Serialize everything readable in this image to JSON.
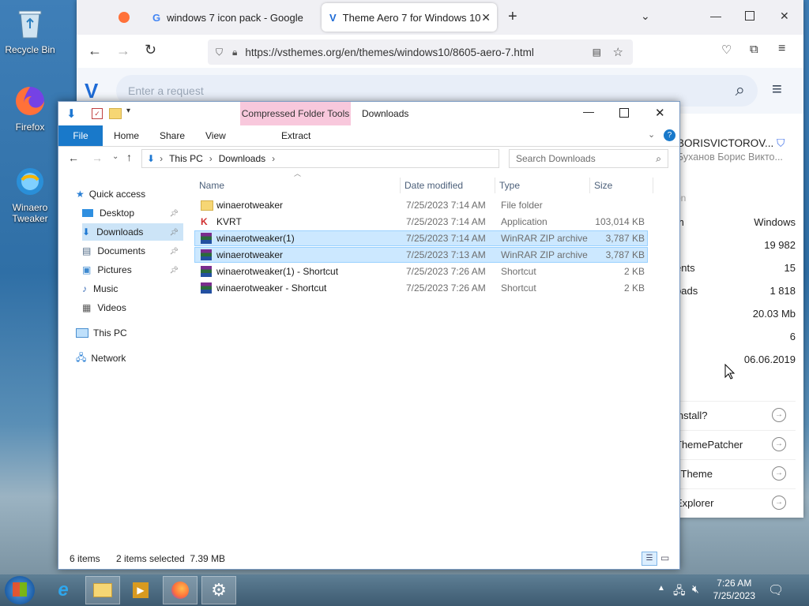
{
  "desktop": {
    "icons": [
      {
        "label": "Recycle Bin"
      },
      {
        "label": "Firefox"
      },
      {
        "label": "Winaero Tweaker"
      }
    ]
  },
  "browser": {
    "tabs": [
      {
        "label": "windows 7 icon pack - Google"
      },
      {
        "label": "Theme Aero 7 for Windows 10"
      }
    ],
    "new_tab": "+",
    "url": "https://vsthemes.org/en/themes/windows10/8605-aero-7.html",
    "site_search_placeholder": "Enter a request",
    "author": {
      "name": "BORISVICTOROV...",
      "subname": "Буханов Борис Викто..."
    },
    "stats_heading": "on",
    "stats": [
      {
        "key": "m",
        "value": "Windows"
      },
      {
        "key": "",
        "value": "19 982"
      },
      {
        "key": "ents",
        "value": "15"
      },
      {
        "key": "oads",
        "value": "1 818"
      },
      {
        "key": "",
        "value": "20.03 Mb"
      },
      {
        "key": "",
        "value": "6"
      },
      {
        "key": "",
        "value": "06.06.2019"
      }
    ],
    "links": [
      {
        "label": "install?"
      },
      {
        "label": "ThemePatcher"
      },
      {
        "label": "xTheme"
      },
      {
        "label": "Explorer"
      }
    ]
  },
  "explorer": {
    "title": "Downloads",
    "context_tab": "Compressed Folder Tools",
    "ribbon_tabs": {
      "file": "File",
      "home": "Home",
      "share": "Share",
      "view": "View",
      "extract": "Extract"
    },
    "breadcrumb": [
      "This PC",
      "Downloads"
    ],
    "search_placeholder": "Search Downloads",
    "nav": {
      "quick_access": "Quick access",
      "items": [
        {
          "label": "Desktop",
          "pinned": true
        },
        {
          "label": "Downloads",
          "pinned": true
        },
        {
          "label": "Documents",
          "pinned": true
        },
        {
          "label": "Pictures",
          "pinned": true
        },
        {
          "label": "Music",
          "pinned": false
        },
        {
          "label": "Videos",
          "pinned": false
        }
      ],
      "this_pc": "This PC",
      "network": "Network"
    },
    "columns": {
      "name": "Name",
      "date": "Date modified",
      "type": "Type",
      "size": "Size"
    },
    "files": [
      {
        "name": "winaerotweaker",
        "date": "7/25/2023 7:14 AM",
        "type": "File folder",
        "size": "",
        "icon": "folder-icon",
        "selected": false
      },
      {
        "name": "KVRT",
        "date": "7/25/2023 7:14 AM",
        "type": "Application",
        "size": "103,014 KB",
        "icon": "app-icon",
        "selected": false
      },
      {
        "name": "winaerotweaker(1)",
        "date": "7/25/2023 7:14 AM",
        "type": "WinRAR ZIP archive",
        "size": "3,787 KB",
        "icon": "archive-icon",
        "selected": true
      },
      {
        "name": "winaerotweaker",
        "date": "7/25/2023 7:13 AM",
        "type": "WinRAR ZIP archive",
        "size": "3,787 KB",
        "icon": "archive-icon",
        "selected": true
      },
      {
        "name": "winaerotweaker(1) - Shortcut",
        "date": "7/25/2023 7:26 AM",
        "type": "Shortcut",
        "size": "2 KB",
        "icon": "archive-shortcut-icon",
        "selected": false
      },
      {
        "name": "winaerotweaker - Shortcut",
        "date": "7/25/2023 7:26 AM",
        "type": "Shortcut",
        "size": "2 KB",
        "icon": "archive-shortcut-icon",
        "selected": false
      }
    ],
    "status": {
      "count": "6 items",
      "selection": "2 items selected  7.39 MB"
    }
  },
  "taskbar": {
    "time": "7:26 AM",
    "date": "7/25/2023"
  },
  "colors": {
    "accent": "#1979ca",
    "selection": "#cce8ff",
    "context_tab": "#f8c8dc"
  }
}
